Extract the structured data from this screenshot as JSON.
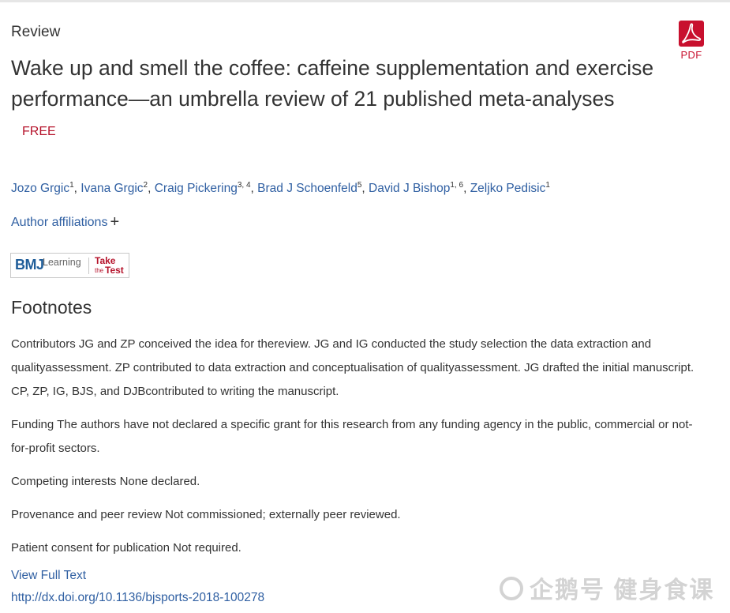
{
  "article": {
    "type": "Review",
    "title": "Wake up and smell the coffee: caffeine supplementation and exercise performance—an umbrella review of 21 published meta-analyses",
    "free_label": "FREE",
    "pdf_label": "PDF"
  },
  "authors": [
    {
      "name": "Jozo Grgic",
      "sup": "1"
    },
    {
      "name": "Ivana Grgic",
      "sup": "2"
    },
    {
      "name": "Craig Pickering",
      "sup": "3, 4"
    },
    {
      "name": "Brad J Schoenfeld",
      "sup": "5"
    },
    {
      "name": "David J Bishop",
      "sup": "1, 6"
    },
    {
      "name": "Zeljko Pedisic",
      "sup": "1"
    }
  ],
  "affiliations_label": "Author affiliations",
  "bmj_badge": {
    "logo": "BMJ",
    "learning": "Learning",
    "take": "Take",
    "the": "the",
    "test": "Test"
  },
  "footnotes": {
    "heading": "Footnotes",
    "items": [
      "Contributors JG and ZP conceived the idea for thereview. JG and IG conducted the study selection the data extraction and qualityassessment. ZP contributed to data extraction and conceptualisation of qualityassessment. JG drafted the initial manuscript. CP, ZP, IG, BJS, and DJBcontributed to writing the manuscript.",
      "Funding The authors have not declared a specific grant for this research from any funding agency in the public, commercial or not-for-profit sectors.",
      "Competing interests None declared.",
      "Provenance and peer review Not commissioned; externally peer reviewed.",
      "Patient consent for publication Not required."
    ]
  },
  "links": {
    "view_full_text": "View Full Text",
    "doi": "http://dx.doi.org/10.1136/bjsports-2018-100278"
  },
  "watermark": "企鹅号 健身食课",
  "colors": {
    "link": "#2f5fa2",
    "accent_red": "#b5132b",
    "pdf_red": "#c8102e",
    "text": "#333333"
  }
}
